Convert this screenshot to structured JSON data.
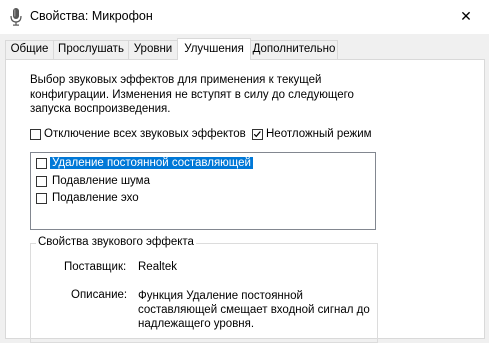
{
  "window": {
    "title": "Свойства: Микрофон",
    "icon": "microphone-icon",
    "close_glyph": "✕"
  },
  "tabs": [
    {
      "label": "Общие"
    },
    {
      "label": "Прослушать"
    },
    {
      "label": "Уровни"
    },
    {
      "label": "Улучшения",
      "active": true
    },
    {
      "label": "Дополнительно"
    }
  ],
  "enhancements": {
    "description": "Выбор звуковых эффектов для применения к текущей конфигурации. Изменения не вступят в силу до следующего запуска воспроизведения.",
    "disable_all_label": "Отключение всех звуковых эффектов",
    "disable_all_checked": false,
    "immediate_mode_label": "Неотложный режим",
    "immediate_mode_checked": true,
    "effects": [
      {
        "label": "Удаление постоянной составляющей",
        "checked": false,
        "selected": true
      },
      {
        "label": "Подавление шума",
        "checked": false,
        "selected": false
      },
      {
        "label": "Подавление эхо",
        "checked": false,
        "selected": false
      }
    ]
  },
  "properties": {
    "group_title": "Свойства звукового эффекта",
    "provider_label": "Поставщик:",
    "provider_value": "Realtek",
    "description_label": "Описание:",
    "description_value": "Функция Удаление постоянной составляющей смещает входной сигнал до надлежащего уровня."
  },
  "colors": {
    "selection": "#0078d7",
    "checkmark": "#000000"
  }
}
